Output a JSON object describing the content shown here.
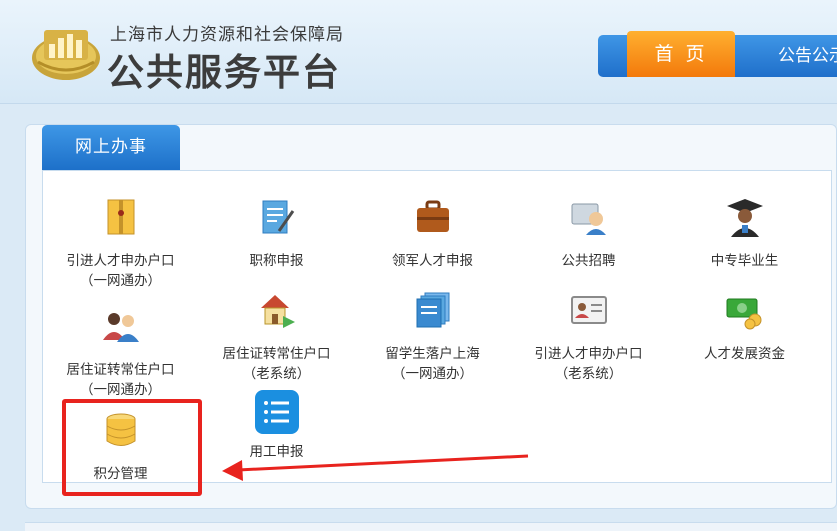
{
  "header": {
    "org_name": "上海市人力资源和社会保障局",
    "site_title": "公共服务平台"
  },
  "nav": {
    "home": "首 页",
    "notice": "公告公示"
  },
  "panel": {
    "tab_label": "网上办事",
    "items": [
      {
        "line1": "引进人才申办户口",
        "line2": "（一网通办）"
      },
      {
        "line1": "职称申报",
        "line2": ""
      },
      {
        "line1": "领军人才申报",
        "line2": ""
      },
      {
        "line1": "公共招聘",
        "line2": ""
      },
      {
        "line1": "中专毕业生",
        "line2": ""
      },
      {
        "line1": "居住证转常住户口",
        "line2": "（一网通办）"
      },
      {
        "line1": "居住证转常住户口",
        "line2": "（老系统）"
      },
      {
        "line1": "留学生落户上海",
        "line2": "（一网通办）"
      },
      {
        "line1": "引进人才申办户口",
        "line2": "（老系统）"
      },
      {
        "line1": "人才发展资金",
        "line2": ""
      },
      {
        "line1": "积分管理",
        "line2": ""
      },
      {
        "line1": "用工申报",
        "line2": ""
      }
    ]
  },
  "colors": {
    "accent_blue": "#1f6fca",
    "accent_orange": "#f3790b",
    "highlight_red": "#e8231e"
  }
}
